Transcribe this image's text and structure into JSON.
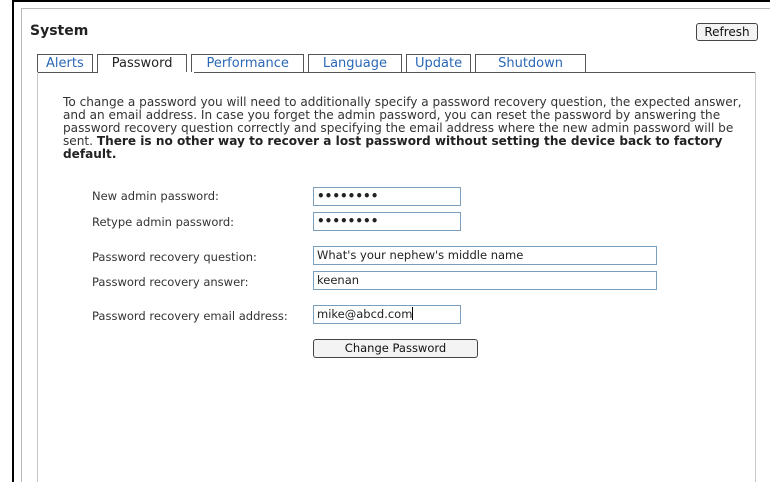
{
  "header": {
    "title": "System",
    "refresh_label": "Refresh"
  },
  "tabs": [
    {
      "label": "Alerts",
      "active": false
    },
    {
      "label": "Password",
      "active": true
    },
    {
      "label": "Performance",
      "active": false
    },
    {
      "label": "Language",
      "active": false
    },
    {
      "label": "Update",
      "active": false
    },
    {
      "label": "Shutdown",
      "active": false
    }
  ],
  "intro": {
    "text": "To change a password you will need to additionally specify a password recovery question, the expected answer, and an email address. In case you forget the admin password, you can reset the password by answering the password recovery question correctly and specifying the email address where the new admin password will be sent. ",
    "bold": "There is no other way to recover a lost password without setting the device back to factory default."
  },
  "form": {
    "new_password_label": "New admin password:",
    "new_password_value": "••••••••",
    "retype_password_label": "Retype admin password:",
    "retype_password_value": "••••••••",
    "question_label": "Password recovery question:",
    "question_value": "What's your nephew's middle name",
    "answer_label": "Password recovery answer:",
    "answer_value": "keenan",
    "email_label": "Password recovery email address:",
    "email_value": "mike@abcd.com",
    "submit_label": "Change Password"
  },
  "colors": {
    "tab_link": "#2a68b6",
    "field_border": "#7b9ebd"
  }
}
